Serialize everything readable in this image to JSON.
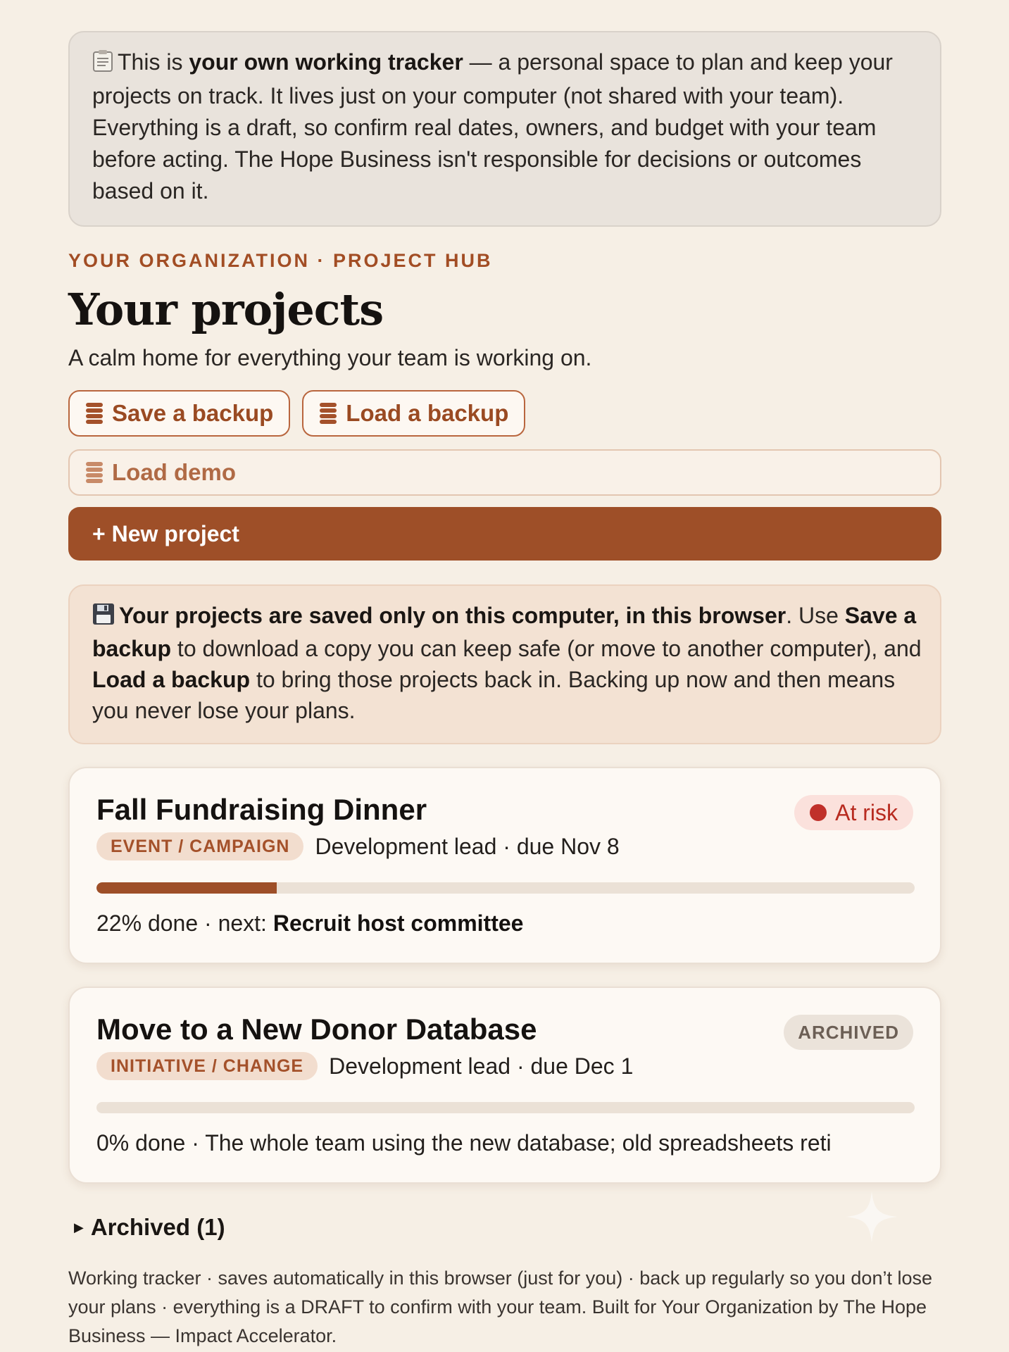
{
  "notice": {
    "icon": "clipboard-icon",
    "pre": "This is ",
    "bold": "your own working tracker",
    "rest": " — a personal space to plan and keep your projects on track. It lives just on your computer (not shared with your team). Everything is a draft, so confirm real dates, owners, and budget with your team before acting. The Hope Business isn't responsible for decisions or outcomes based on it."
  },
  "header": {
    "eyebrow": "YOUR ORGANIZATION · PROJECT HUB",
    "title": "Your projects",
    "subtitle": "A calm home for everything your team is working on."
  },
  "actions": {
    "save_backup": "Save a backup",
    "load_backup": "Load a backup",
    "load_demo": "Load demo",
    "new_project": "+ New project",
    "icon": "database-icon"
  },
  "backup_note": {
    "icon": "floppy-disk-icon",
    "bold1": "Your projects are saved only on this computer, in this browser",
    "t1": ". Use ",
    "bold2": "Save a backup",
    "t2": " to download a copy you can keep safe (or move to another computer), and ",
    "bold3": "Load a backup",
    "t3": " to bring those projects back in. Backing up now and then means you never lose your plans."
  },
  "projects": [
    {
      "name": "Fall Fundraising Dinner",
      "tag": "EVENT / CAMPAIGN",
      "meta": "Development lead · due Nov 8",
      "status": "At risk",
      "progress": 22,
      "progress_text": "22% done · next: ",
      "next": "Recruit host committee",
      "colors": {
        "status_dot": "#c0302a"
      }
    },
    {
      "name": "Move to a New Donor Database",
      "tag": "INITIATIVE / CHANGE",
      "meta": "Development lead · due Dec 1",
      "status": "ARCHIVED",
      "progress": 0,
      "progress_text": "0% done · The whole team using the new database; old spreadsheets reti"
    }
  ],
  "archived_toggle": "Archived (1)",
  "footer": "Working tracker · saves automatically in this browser (just for you) · back up regularly so you don’t lose your plans · everything is a DRAFT to confirm with your team. Built for Your Organization by The Hope Business — Impact Accelerator.",
  "colors": {
    "accent": "#9e4f28",
    "background": "#f6efe5",
    "risk": "#b82b20"
  }
}
